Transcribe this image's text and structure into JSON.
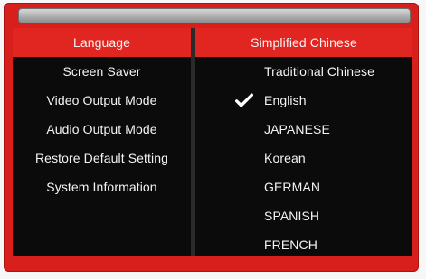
{
  "menu": {
    "left_items": [
      {
        "label": "Language",
        "selected": true
      },
      {
        "label": "Screen Saver",
        "selected": false
      },
      {
        "label": "Video Output Mode",
        "selected": false
      },
      {
        "label": "Audio Output Mode",
        "selected": false
      },
      {
        "label": "Restore Default Setting",
        "selected": false
      },
      {
        "label": "System Information",
        "selected": false
      }
    ],
    "right_items": [
      {
        "label": "Simplified Chinese",
        "selected": true,
        "checked": false
      },
      {
        "label": "Traditional Chinese",
        "selected": false,
        "checked": false
      },
      {
        "label": "English",
        "selected": false,
        "checked": true
      },
      {
        "label": "JAPANESE",
        "selected": false,
        "checked": false
      },
      {
        "label": "Korean",
        "selected": false,
        "checked": false
      },
      {
        "label": "GERMAN",
        "selected": false,
        "checked": false
      },
      {
        "label": "SPANISH",
        "selected": false,
        "checked": false
      },
      {
        "label": "FRENCH",
        "selected": false,
        "checked": false
      }
    ]
  },
  "colors": {
    "frame": "#d81f1b",
    "highlight": "#e12520",
    "panel": "#0b0b0b",
    "text": "#f4f4f4"
  },
  "icons": {
    "check": "checkmark-icon"
  }
}
